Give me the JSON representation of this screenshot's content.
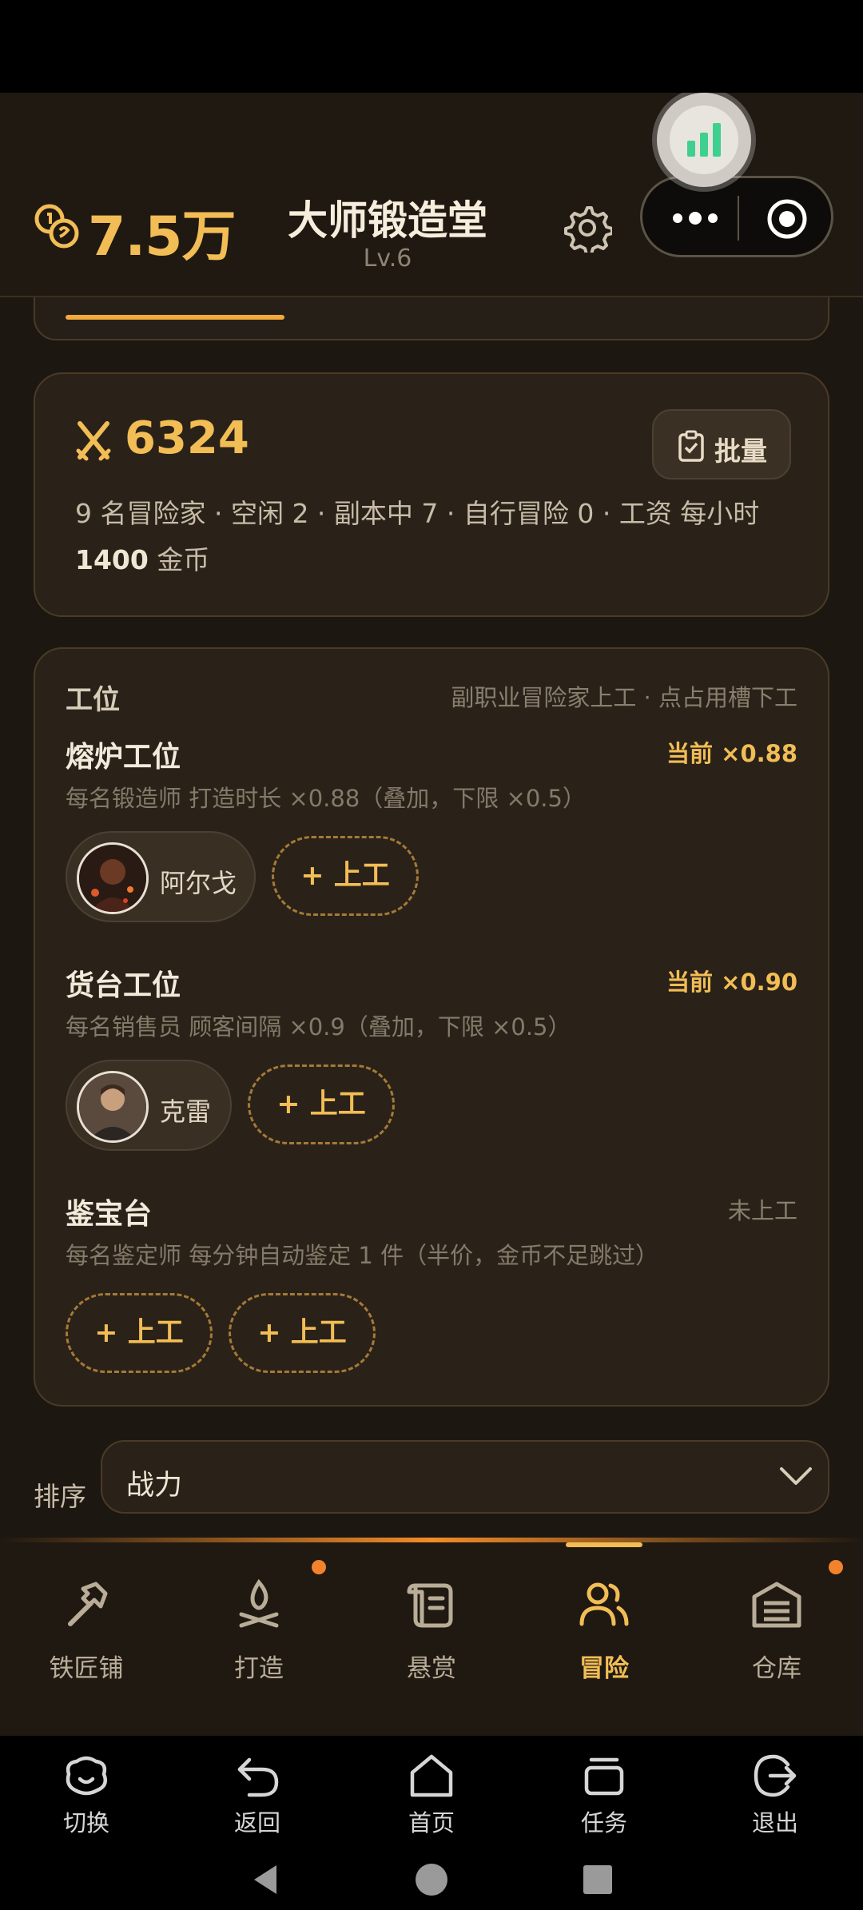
{
  "header": {
    "gold": "7.5万",
    "title": "大师锻造堂",
    "level": "Lv.6"
  },
  "stats": {
    "power": "6324",
    "batch_label": "批量",
    "line_prefix": "9 名冒险家 · 空闲 2 · 副本中 7 · 自行冒险 0 · 工资 每小时 ",
    "wage": "1400",
    "line_suffix": " 金币"
  },
  "stations": {
    "title": "工位",
    "hint": "副职业冒险家上工 · 点占用槽下工",
    "sections": [
      {
        "name": "熔炉工位",
        "multiplier": "当前 ×0.88",
        "desc": "每名锻造师 打造时长 ×0.88（叠加，下限 ×0.5）",
        "worker": "阿尔戈",
        "slot_label": "+ 上工"
      },
      {
        "name": "货台工位",
        "multiplier": "当前 ×0.90",
        "desc": "每名销售员 顾客间隔 ×0.9（叠加，下限 ×0.5）",
        "worker": "克雷",
        "slot_label": "+ 上工"
      },
      {
        "name": "鉴宝台",
        "status": "未上工",
        "desc": "每名鉴定师 每分钟自动鉴定 1 件（半价，金币不足跳过）",
        "slot_labels": [
          "+ 上工",
          "+ 上工"
        ]
      }
    ]
  },
  "sort": {
    "label": "排序",
    "value": "战力"
  },
  "nav": {
    "active": "冒险",
    "items": [
      {
        "label": "铁匠铺",
        "icon": "hammer-icon",
        "badge": false
      },
      {
        "label": "打造",
        "icon": "campfire-icon",
        "badge": true
      },
      {
        "label": "悬赏",
        "icon": "scroll-icon",
        "badge": false
      },
      {
        "label": "冒险",
        "icon": "users-icon",
        "badge": false
      },
      {
        "label": "仓库",
        "icon": "warehouse-icon",
        "badge": true
      }
    ]
  },
  "system_bar": {
    "items": [
      {
        "label": "切换",
        "icon": "switch-icon"
      },
      {
        "label": "返回",
        "icon": "back-icon"
      },
      {
        "label": "首页",
        "icon": "home-icon"
      },
      {
        "label": "任务",
        "icon": "tasks-icon"
      },
      {
        "label": "退出",
        "icon": "exit-icon"
      }
    ]
  },
  "colors": {
    "accent": "#f2bd55",
    "background": "#1c1711",
    "card": "#2a2219",
    "badge": "#f2832c"
  }
}
